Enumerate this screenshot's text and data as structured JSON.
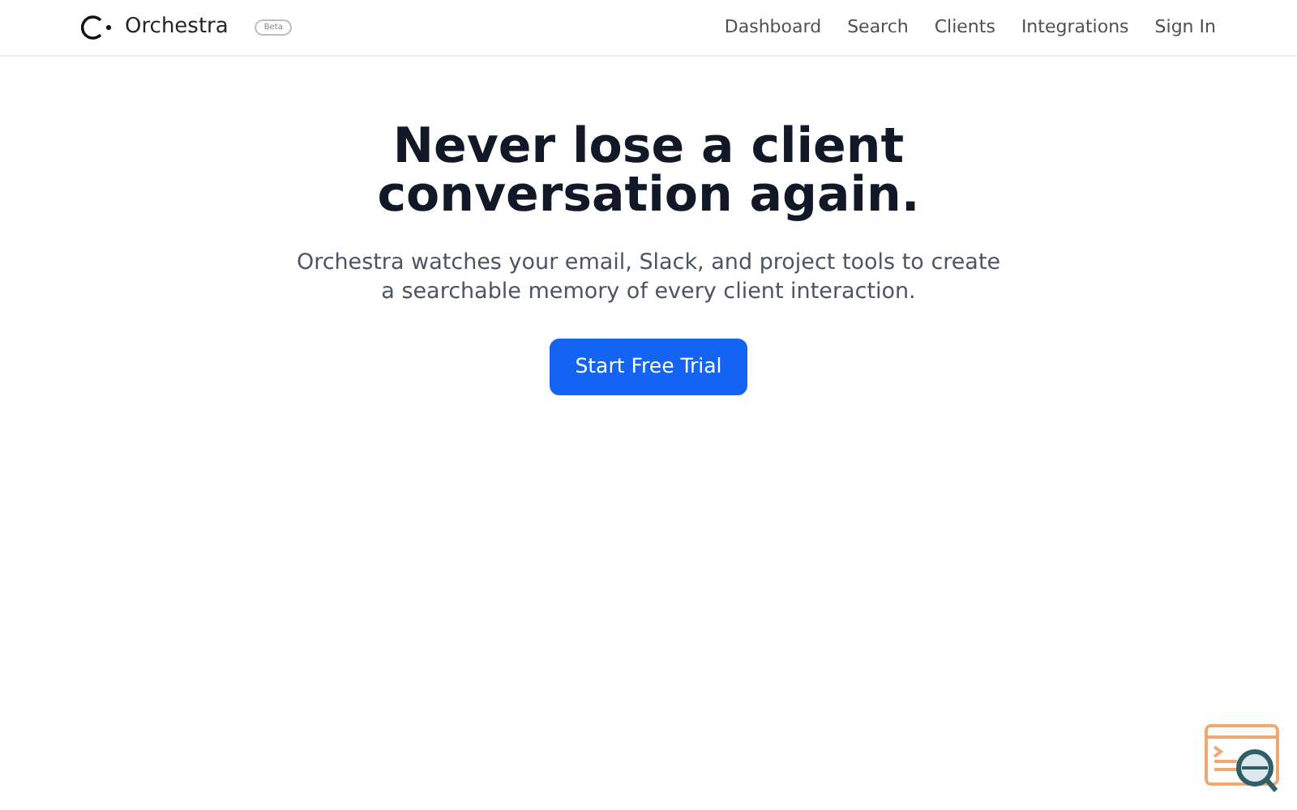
{
  "brand": {
    "name": "Orchestra",
    "badge": "Beta"
  },
  "nav": [
    {
      "label": "Dashboard"
    },
    {
      "label": "Search"
    },
    {
      "label": "Clients"
    },
    {
      "label": "Integrations"
    },
    {
      "label": "Sign In"
    }
  ],
  "hero": {
    "title": "Never lose a client conversation again.",
    "subtitle": "Orchestra watches your email, Slack, and project tools to create a searchable memory of every client interaction.",
    "button": "Start Free Trial"
  }
}
